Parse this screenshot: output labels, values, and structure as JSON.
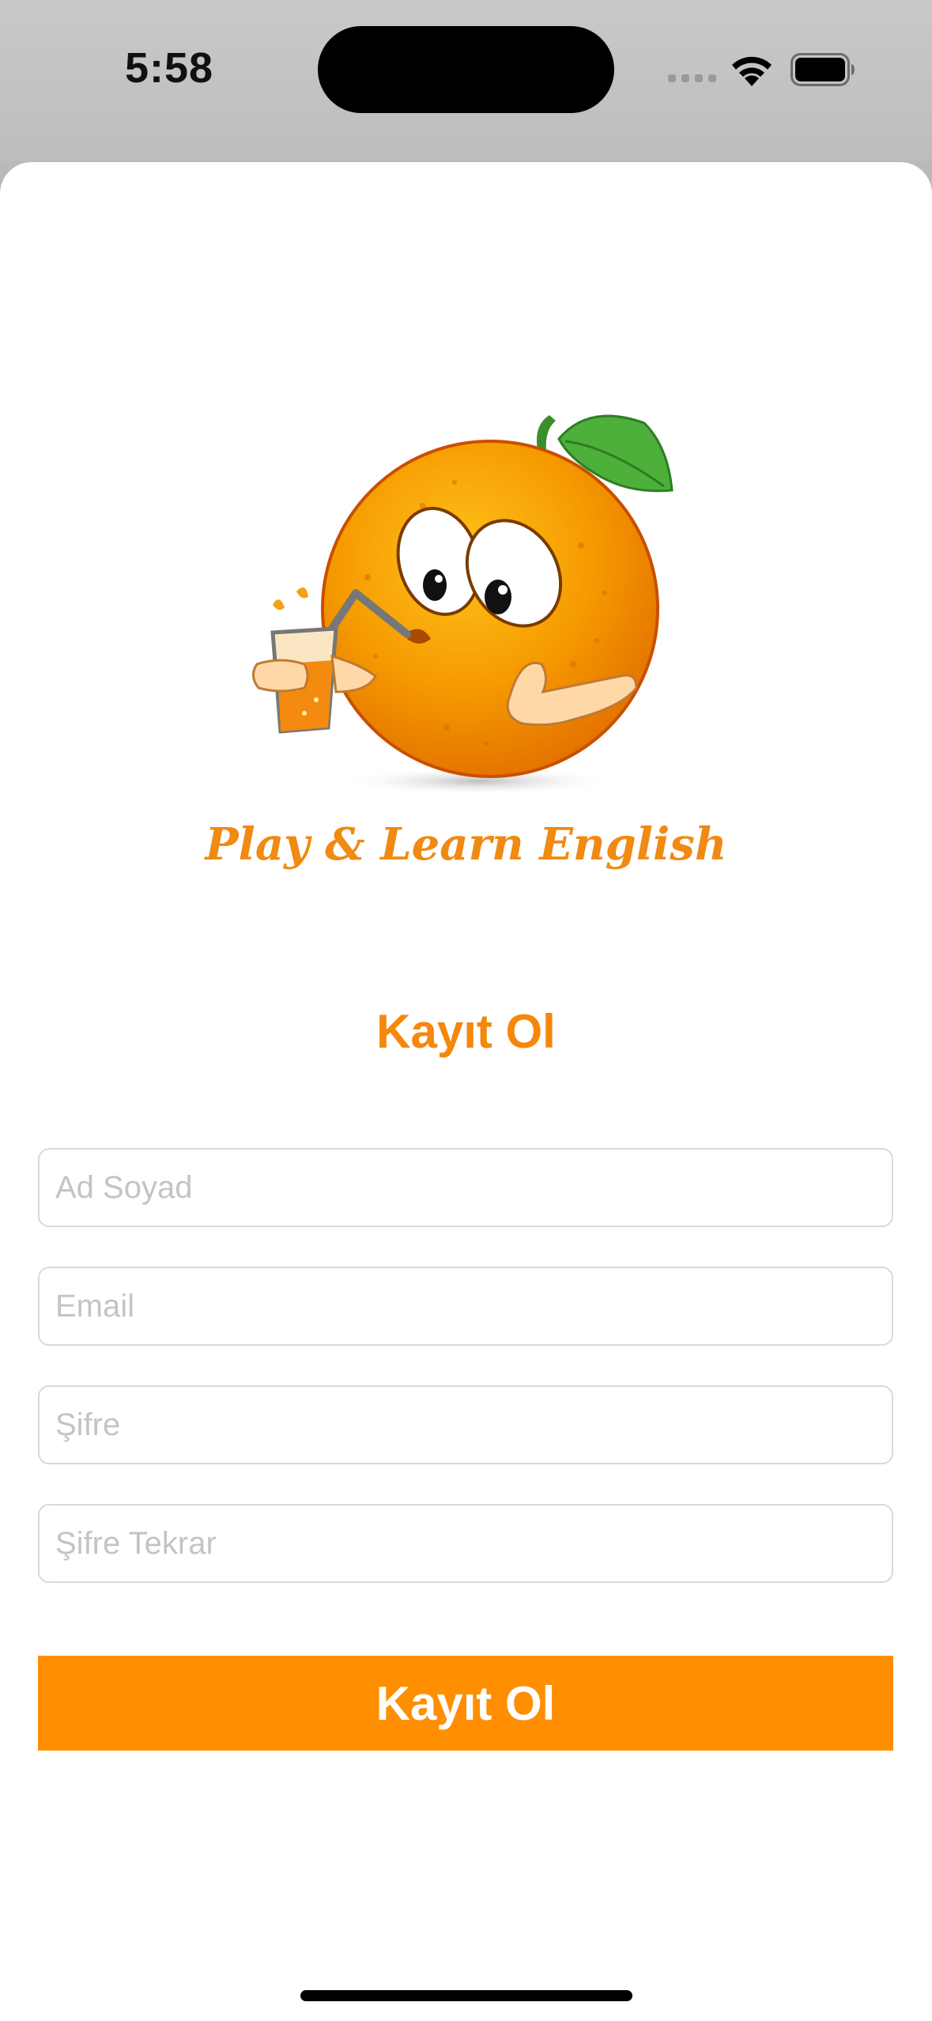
{
  "status_bar": {
    "time": "5:58",
    "icons": [
      "signal-icon",
      "wifi-icon",
      "battery-icon"
    ]
  },
  "brand": {
    "logo_text": "Play & Learn English",
    "mascot": "orange-mascot-illustration",
    "accent_color": "#ff8f00"
  },
  "form": {
    "title": "Kayıt Ol",
    "fields": [
      {
        "placeholder": "Ad Soyad",
        "value": ""
      },
      {
        "placeholder": "Email",
        "value": ""
      },
      {
        "placeholder": "Şifre",
        "value": ""
      },
      {
        "placeholder": "Şifre Tekrar",
        "value": ""
      }
    ],
    "submit_label": "Kayıt Ol"
  }
}
